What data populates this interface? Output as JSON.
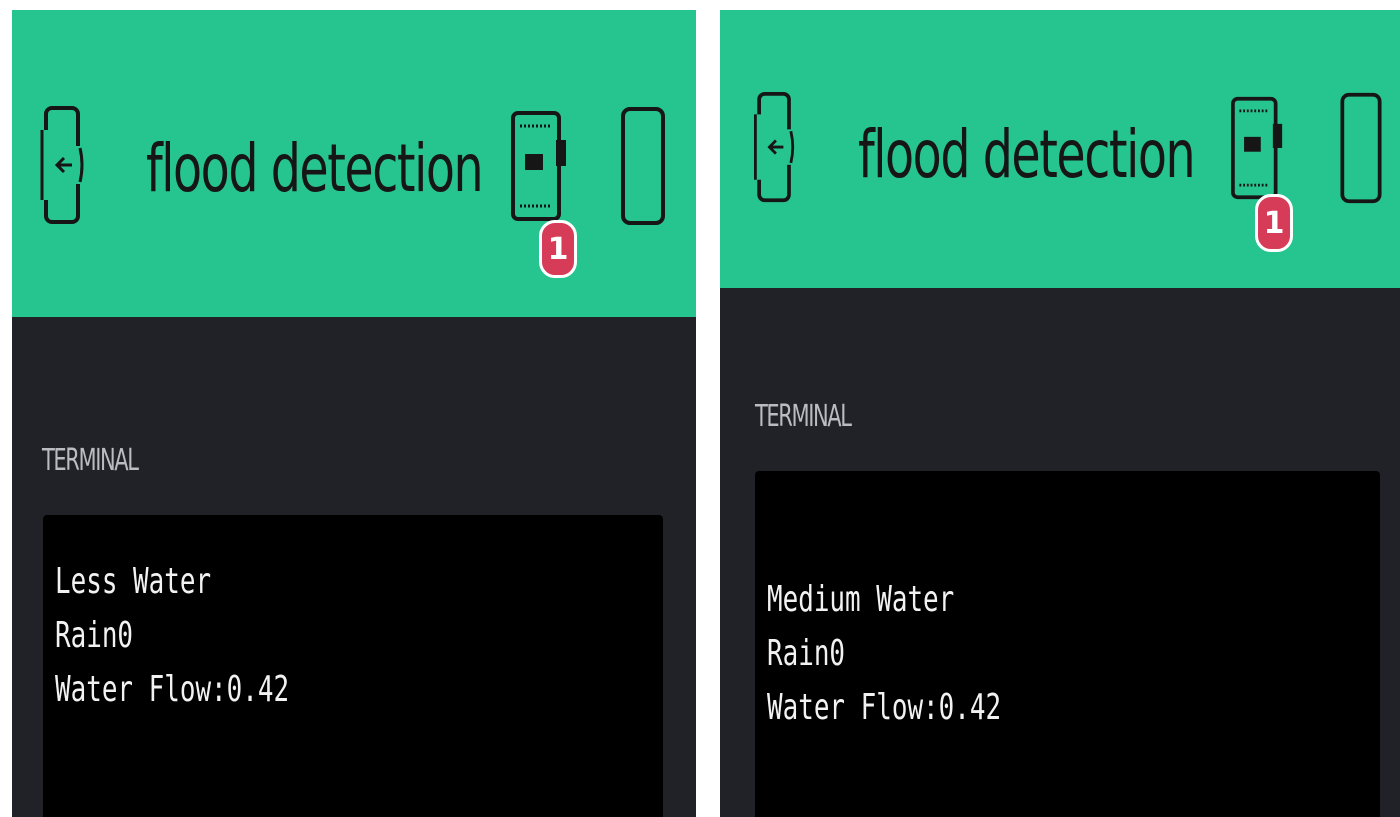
{
  "screens": [
    {
      "header": {
        "title": "flood detection",
        "device_badge": "1"
      },
      "terminal": {
        "label": "TERMINAL",
        "lines": [
          "Less Water",
          "Rain0",
          "Water Flow:0.42"
        ]
      }
    },
    {
      "header": {
        "title": "flood detection",
        "device_badge": "1"
      },
      "terminal": {
        "label": "TERMINAL",
        "lines": [
          "Medium Water",
          "Rain0",
          "Water Flow:0.42"
        ]
      }
    }
  ],
  "icons": {
    "back": "exit-app-icon",
    "device": "hardware-board-icon",
    "profile": "phone-frame-icon"
  },
  "colors": {
    "header_green": "#26c48f",
    "background": "#212227",
    "terminal_bg": "#000000",
    "badge_red": "#d63b57"
  }
}
